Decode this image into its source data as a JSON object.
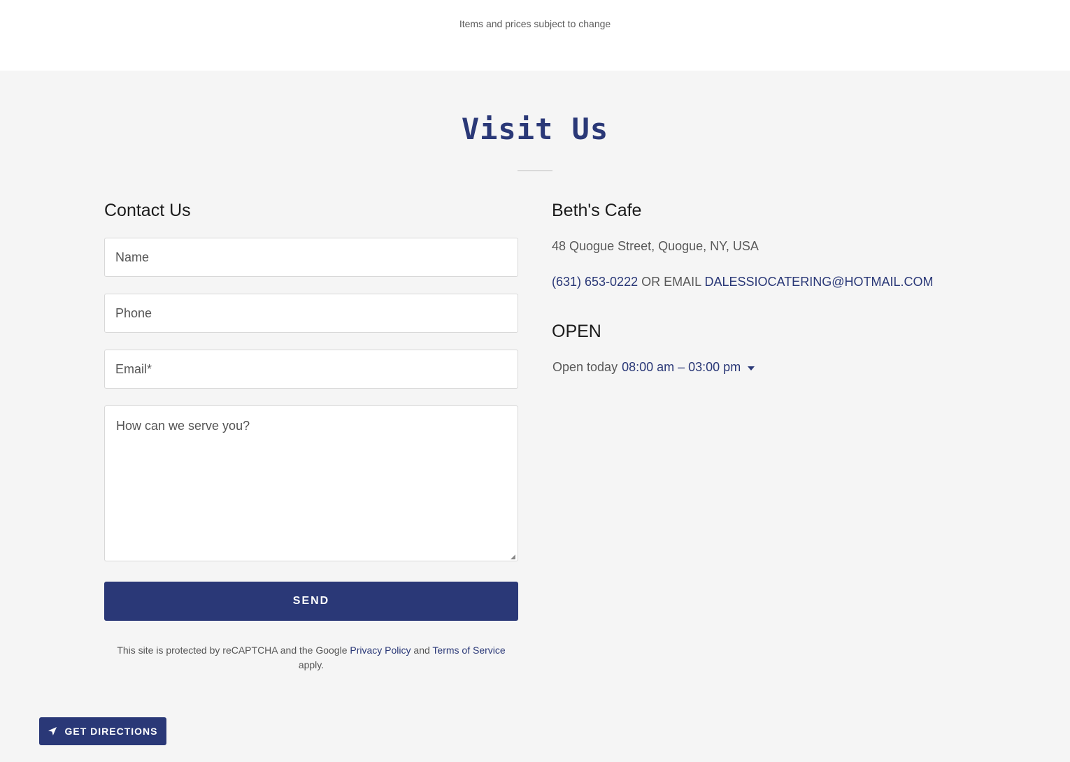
{
  "top": {
    "note": "Items and prices subject to change"
  },
  "section": {
    "title": "Visit Us"
  },
  "contact": {
    "heading": "Contact Us",
    "name_placeholder": "Name",
    "phone_placeholder": "Phone",
    "email_placeholder": "Email*",
    "message_placeholder": "How can we serve you?",
    "send_label": "SEND",
    "recaptcha_prefix": "This site is protected by reCAPTCHA and the Google",
    "privacy_link": "Privacy Policy",
    "and_text": "and",
    "terms_link": "Terms of Service",
    "apply_text": "apply."
  },
  "business": {
    "name": "Beth's Cafe",
    "address": "48 Quogue Street, Quogue, NY, USA",
    "phone": "(631) 653-0222",
    "or_email_text": "OR EMAIL",
    "email": "DALESSIOCATERING@HOTMAIL.COM",
    "open_heading": "OPEN",
    "open_today_label": "Open today",
    "hours": "08:00 am – 03:00 pm"
  },
  "directions": {
    "label": "GET DIRECTIONS",
    "icon": "navigation-arrow-icon"
  },
  "colors": {
    "accent": "#2a3877",
    "background": "#f5f5f5",
    "top_band": "#ffffff"
  }
}
